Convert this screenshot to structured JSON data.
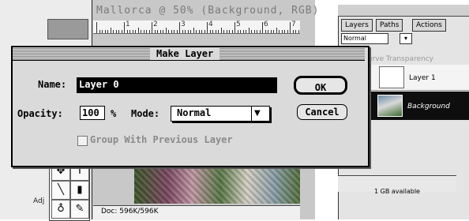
{
  "document": {
    "title": "Mallorca @ 50% (Background, RGB)",
    "ruler_numbers": [
      "1",
      "2",
      "3",
      "4",
      "5",
      "6",
      "7"
    ],
    "status_size": "Doc: 596K/596K"
  },
  "toolbox": {
    "adjust_label": "Adj"
  },
  "layers_palette": {
    "tabs": [
      "Layers",
      "Paths",
      "Actions"
    ],
    "blend_mode": "Normal",
    "preserve_label": "erve Transparency",
    "layers": [
      {
        "name": "Layer 1"
      },
      {
        "name": "Background"
      }
    ],
    "memory_label": "1 GB available"
  },
  "dialog": {
    "title": "Make Layer",
    "name_label": "Name:",
    "name_value": "Layer 0",
    "opacity_label": "Opacity:",
    "opacity_value": "100",
    "percent": "%",
    "mode_label": "Mode:",
    "mode_value": "Normal",
    "group_label": "Group With Previous Layer",
    "ok_label": "OK",
    "cancel_label": "Cancel"
  },
  "colors": {
    "selection": "#000000",
    "dialog_bg": "#dadada"
  }
}
